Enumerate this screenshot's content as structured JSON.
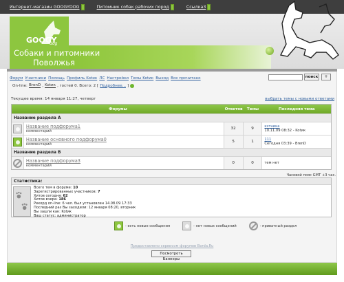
{
  "topnav": [
    {
      "label": "Интернет-магазин GOOGYDOG"
    },
    {
      "label": "Питомник собак рабочих пород"
    },
    {
      "label": "Ссылка3"
    }
  ],
  "header": {
    "logo_word": "GOOGY",
    "logo_dog": "dog",
    "title_line1": "Собаки и питомники",
    "title_line2": "Поволжья"
  },
  "menu": [
    {
      "label": "Форум"
    },
    {
      "label": "Участники"
    },
    {
      "label": "Помощь"
    },
    {
      "label": "Профиль Kotик"
    },
    {
      "label": "ЛС"
    },
    {
      "label": "Настройки"
    },
    {
      "label": "Темы Kotик"
    },
    {
      "label": "Выход"
    },
    {
      "label": "Все прочитано"
    }
  ],
  "search": {
    "value": "",
    "button": "поиск",
    "plus": "+"
  },
  "online": {
    "prefix": "On-line:",
    "user1": "BrenD",
    "user2": "Kotик",
    "suffix": ", гостей 0. Всего: 2 [",
    "link": "Подробнее...",
    "close": "]"
  },
  "time_text": "Текущее время: 14 января 11:27, четверг",
  "mark_read": "выбрать темы с новыми ответами",
  "table": {
    "headers": [
      "Форумы",
      "Ответов",
      "Темы",
      "Последняя тема"
    ],
    "sections": [
      {
        "title": "Название раздела А",
        "rows": [
          {
            "name": "Название подфорума1",
            "desc": "комментарий",
            "replies": "32",
            "topics": "9",
            "last_title": "кэтника",
            "last_info": "10.11.09 08:32 - Kotик",
            "icon": "new"
          },
          {
            "name": "Название основного подфорума0",
            "desc": "комментарий",
            "replies": "5",
            "topics": "1",
            "last_title": "111",
            "last_info": "Сегодня 03:39 - BrenD",
            "icon": "new"
          }
        ]
      },
      {
        "title": "Название раздела В",
        "rows": [
          {
            "name": "Название подфорума3",
            "desc": "комментарий",
            "replies": "0",
            "topics": "0",
            "last_title": "",
            "last_info": "тем нет",
            "icon": "lock"
          }
        ]
      }
    ]
  },
  "timezone": "Часовой пояс GMT +3 час.",
  "stats": {
    "title": "Статистика:",
    "lines": [
      {
        "label": "Всего тем в форуме: ",
        "value": "10"
      },
      {
        "label": "Зарегистрированных участников: ",
        "value": "7"
      },
      {
        "label": "Хитов сегодня: ",
        "value": "62"
      },
      {
        "label": "Хитов вчера: ",
        "value": "186"
      },
      {
        "label": "Рекорд on-line: ",
        "value": "6 чел. был установлен 14.08.09 17:33"
      },
      {
        "label": "Последний раз Вы заходили: ",
        "value": "12 января 08:20, вторник"
      },
      {
        "label": "Вы зашли как: ",
        "value": "Kotик"
      },
      {
        "label": "Ваш статус: ",
        "value": "администратор"
      }
    ]
  },
  "legend": {
    "new": "- есть новые сообщения",
    "none": "- нет новых сообщений",
    "private": "- приватный раздел"
  },
  "powered": "Предоставлено сервисом форумов Borda.Ru",
  "banners_button": "Посмотреть Баннеры",
  "colors": {
    "accent": "#8dc63f",
    "accent_dark": "#6ea826",
    "link": "#2e5f9e"
  }
}
